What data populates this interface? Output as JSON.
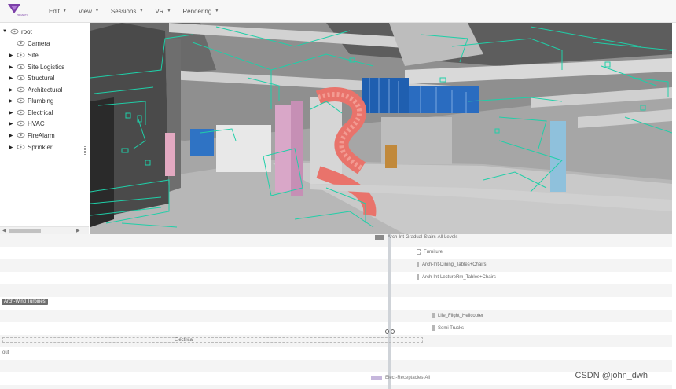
{
  "menu": {
    "logo_text": "PROALITY",
    "items": [
      {
        "label": "Edit",
        "icon": "caret-down-icon"
      },
      {
        "label": "View",
        "icon": "caret-down-icon"
      },
      {
        "label": "Sessions",
        "icon": "caret-down-icon"
      },
      {
        "label": "VR",
        "icon": "caret-down-icon"
      },
      {
        "label": "Rendering",
        "icon": "caret-down-icon"
      }
    ]
  },
  "tree": {
    "root": "root",
    "items": [
      {
        "label": "Camera",
        "expandable": false
      },
      {
        "label": "Site",
        "expandable": true
      },
      {
        "label": "Site Logistics",
        "expandable": true
      },
      {
        "label": "Structural",
        "expandable": true
      },
      {
        "label": "Architectural",
        "expandable": true
      },
      {
        "label": "Plumbing",
        "expandable": true
      },
      {
        "label": "Electrical",
        "expandable": true
      },
      {
        "label": "HVAC",
        "expandable": true
      },
      {
        "label": "FireAlarm",
        "expandable": true
      },
      {
        "label": "Sprinkler",
        "expandable": true
      }
    ]
  },
  "timeline": {
    "top_label": "Arch-Int-Gradual-Stairs-All Levels",
    "rows": [
      {
        "label": "Furniture",
        "style": "dash"
      },
      {
        "label": "Arch-Int-Dining_Tables+Chairs",
        "style": "solid"
      },
      {
        "label": "Arch-Int-LectureRm_Tables+Chairs",
        "style": "solid"
      },
      {
        "label": "Life_Flight_Helicopter",
        "style": "solid"
      },
      {
        "label": "Semi Trucks",
        "style": "solid"
      }
    ],
    "badge": "Arch-Wind Turbines",
    "dashed_group": "Electrical",
    "out_label": "out",
    "bottom_label": "Elect-Receptacles-All"
  },
  "watermark": "CSDN @john_dwh",
  "colors": {
    "accent": "#7b3fa8",
    "overlay_lines": "#1fcfa8",
    "stair": "#e9736b"
  }
}
